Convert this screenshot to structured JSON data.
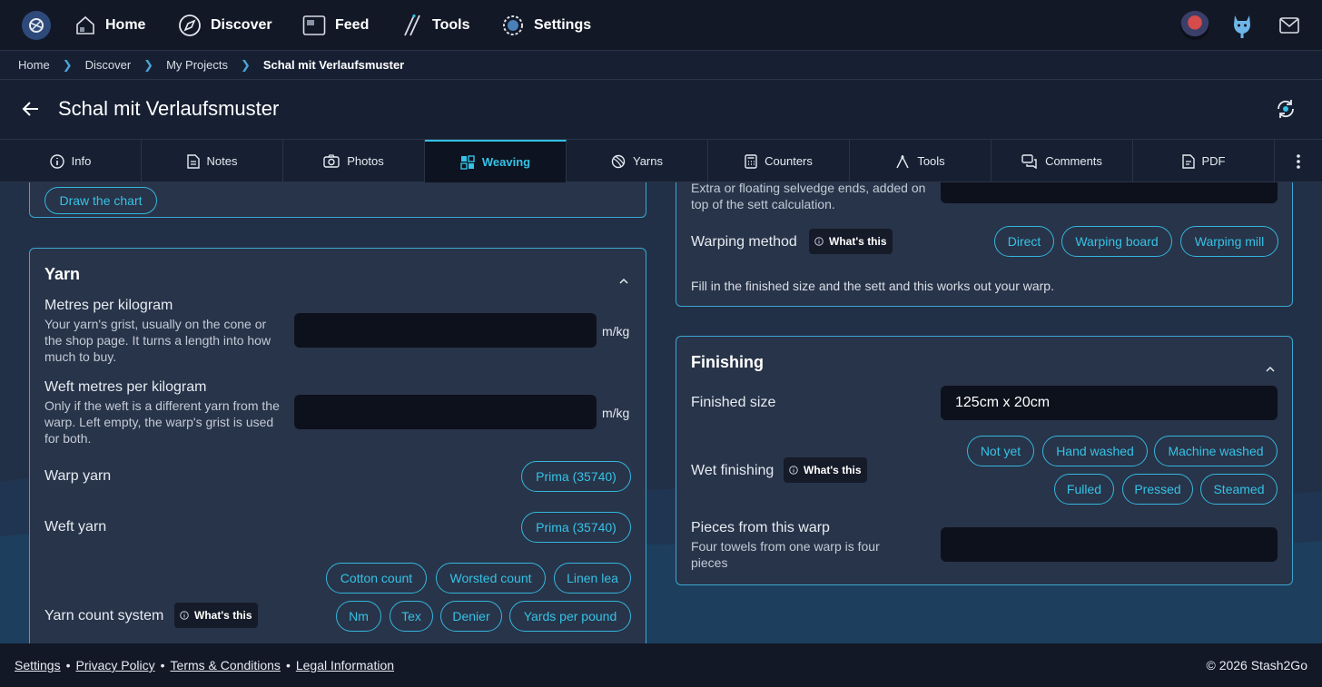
{
  "nav": {
    "items": [
      {
        "label": "Home",
        "icon": "home-icon"
      },
      {
        "label": "Discover",
        "icon": "compass-icon"
      },
      {
        "label": "Feed",
        "icon": "feed-icon"
      },
      {
        "label": "Tools",
        "icon": "needles-icon"
      },
      {
        "label": "Settings",
        "icon": "gear-icon"
      }
    ]
  },
  "breadcrumb": {
    "items": [
      "Home",
      "Discover",
      "My Projects"
    ],
    "current": "Schal mit Verlaufsmuster"
  },
  "header": {
    "title": "Schal mit Verlaufsmuster"
  },
  "tabs": [
    {
      "label": "Info",
      "icon": "info-icon"
    },
    {
      "label": "Notes",
      "icon": "document-icon"
    },
    {
      "label": "Photos",
      "icon": "camera-icon"
    },
    {
      "label": "Weaving",
      "icon": "grid-icon",
      "active": true
    },
    {
      "label": "Yarns",
      "icon": "yarn-icon"
    },
    {
      "label": "Counters",
      "icon": "calculator-icon"
    },
    {
      "label": "Tools",
      "icon": "tools-icon"
    },
    {
      "label": "Comments",
      "icon": "comments-icon"
    },
    {
      "label": "PDF",
      "icon": "pdf-icon"
    }
  ],
  "top_left_card": {
    "draw_chart_label": "Draw the chart"
  },
  "yarn": {
    "title": "Yarn",
    "metres_per_kg": {
      "label": "Metres per kilogram",
      "help": "Your yarn's grist, usually on the cone or the shop page. It turns a length into how much to buy.",
      "value": "",
      "unit": "m/kg"
    },
    "weft_metres_per_kg": {
      "label": "Weft metres per kilogram",
      "help": "Only if the weft is a different yarn from the warp. Left empty, the warp's grist is used for both.",
      "value": "",
      "unit": "m/kg"
    },
    "warp_yarn": {
      "label": "Warp yarn",
      "value": "Prima (35740)"
    },
    "weft_yarn": {
      "label": "Weft yarn",
      "value": "Prima (35740)"
    },
    "yarn_count_system": {
      "label": "Yarn count system",
      "whats_this": "What's this",
      "options": [
        "Cotton count",
        "Worsted count",
        "Linen lea",
        "Nm",
        "Tex",
        "Denier",
        "Yards per pound"
      ]
    }
  },
  "warp": {
    "selvedge_help": "Extra or floating selvedge ends, added on top of the sett calculation.",
    "warping_method": {
      "label": "Warping method",
      "whats_this": "What's this",
      "options": [
        "Direct",
        "Warping board",
        "Warping mill"
      ]
    },
    "info": "Fill in the finished size and the sett and this works out your warp."
  },
  "finishing": {
    "title": "Finishing",
    "finished_size": {
      "label": "Finished size",
      "value": "125cm x 20cm"
    },
    "wet_finishing": {
      "label": "Wet finishing",
      "whats_this": "What's this",
      "options": [
        "Not yet",
        "Hand washed",
        "Machine washed",
        "Fulled",
        "Pressed",
        "Steamed"
      ]
    },
    "pieces": {
      "label": "Pieces from this warp",
      "help": "Four towels from one warp is four pieces",
      "value": ""
    }
  },
  "footer": {
    "links": [
      "Settings",
      "Privacy Policy",
      "Terms & Conditions",
      "Legal Information"
    ],
    "copyright": "© 2026 Stash2Go"
  }
}
